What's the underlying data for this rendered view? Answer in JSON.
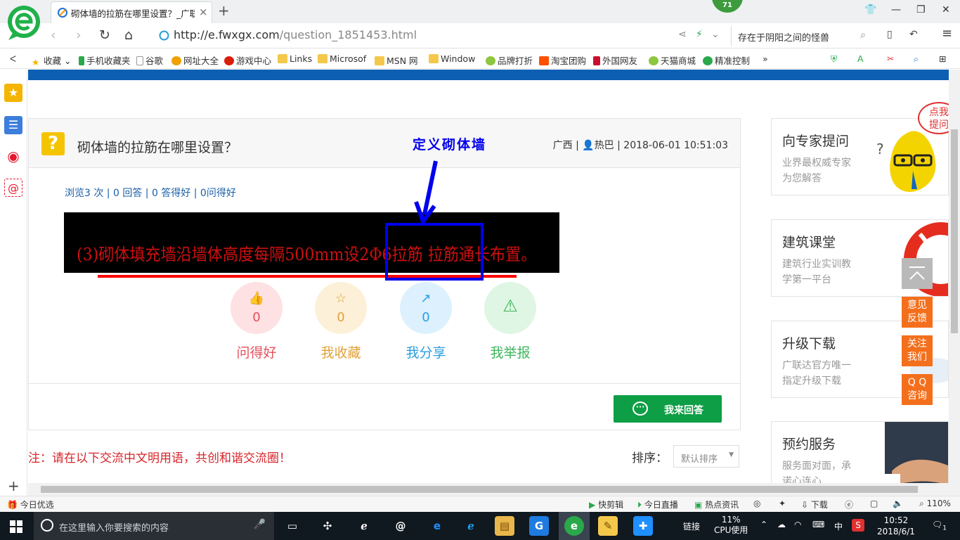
{
  "browser": {
    "tab_title": "砌体墙的拉筋在哪里设置？_广联",
    "tab_close": "×",
    "new_tab": "+",
    "badge": "71",
    "url_host": "http://e.fwxgx.com",
    "url_path": "/question_1851453.html",
    "search_text": "存在于阴阳之间的怪兽"
  },
  "bookmarks": [
    {
      "label": "收藏",
      "color": "#f5b400"
    },
    {
      "label": "手机收藏夹",
      "color": "#2aa84a"
    },
    {
      "label": "谷歌",
      "color": "#cccccc"
    },
    {
      "label": "网址大全",
      "color": "#f0a000"
    },
    {
      "label": "游戏中心",
      "color": "#d81e06"
    },
    {
      "label": "Links",
      "color": "#f3c84b"
    },
    {
      "label": "Microsof",
      "color": "#f3c84b"
    },
    {
      "label": "MSN 网",
      "color": "#f3c84b"
    },
    {
      "label": "Window",
      "color": "#f3c84b"
    },
    {
      "label": "品牌打折",
      "color": "#8dc63f"
    },
    {
      "label": "淘宝团购",
      "color": "#ff5000"
    },
    {
      "label": "外国网友",
      "color": "#c8102e"
    },
    {
      "label": "天猫商城",
      "color": "#8dc63f"
    },
    {
      "label": "精准控制",
      "color": "#2aa84a"
    }
  ],
  "question": {
    "icon": "?",
    "title": "砌体墙的拉筋在哪里设置？",
    "meta_region": "广西 |",
    "meta_user": "热巴 | 2018-06-01 10:51:03",
    "stats": "浏览3 次 | 0 回答 | 0 答得好 | 0问得好",
    "image_text": "(3)砌体填充墙沿墙体高度每隔500mm设2Φ6拉筋 拉筋通长布置。",
    "annotation": "定义砌体墙"
  },
  "actions": [
    {
      "label": "问得好",
      "count": "0",
      "icon": "👍",
      "bg": "#fde1e3",
      "color": "#e5505c"
    },
    {
      "label": "我收藏",
      "count": "0",
      "icon": "☆",
      "bg": "#fdf0d8",
      "color": "#e0a23a"
    },
    {
      "label": "我分享",
      "count": "0",
      "icon": "↗",
      "bg": "#dcf1fd",
      "color": "#2c9ee0"
    },
    {
      "label": "我举报",
      "count": "",
      "icon": "⚠",
      "bg": "#dff6e4",
      "color": "#3db65c"
    }
  ],
  "answer_button": "我来回答",
  "answer_icon": "···",
  "note": "注：请在以下交流中文明用语，共创和谐交流圈！",
  "sort": {
    "label": "排序：",
    "value": "默认排序",
    "arrow": "▼"
  },
  "side_cards": [
    {
      "title": "向专家提问",
      "sub1": "业界最权威专家",
      "sub2": "为您解答"
    },
    {
      "title": "建筑课堂",
      "sub1": "建筑行业实训教",
      "sub2": "学第一平台"
    },
    {
      "title": "升级下载",
      "sub1": "广联达官方唯一",
      "sub2": "指定升级下载"
    },
    {
      "title": "预约服务",
      "sub1": "服务面对面，承",
      "sub2": "诺心连心"
    }
  ],
  "bubble_text": {
    "line1": "点我",
    "line2": "提问"
  },
  "float_buttons": [
    {
      "l1": "意见",
      "l2": "反馈"
    },
    {
      "l1": "关注",
      "l2": "我们"
    },
    {
      "l1": "Q Q",
      "l2": "咨询"
    }
  ],
  "statusbar": {
    "left": "今日优选",
    "items": [
      "快剪辑",
      "今日直播",
      "热点资讯"
    ],
    "download": "下载",
    "zoom": "110%"
  },
  "taskbar": {
    "search_placeholder": "在这里输入你要搜索的内容",
    "network": "链接",
    "cpu_pct": "11%",
    "cpu_label": "CPU使用",
    "ime": "中",
    "time": "10:52",
    "date": "2018/6/1",
    "notif_count": "1"
  }
}
